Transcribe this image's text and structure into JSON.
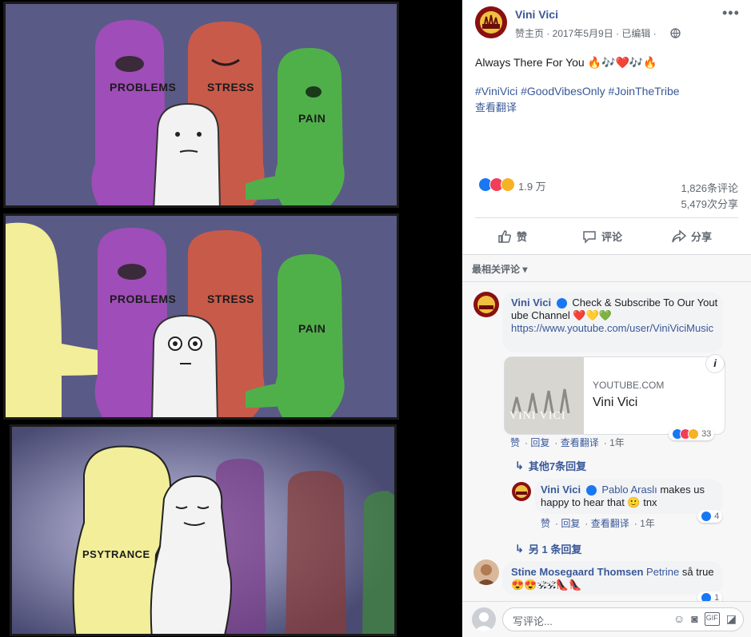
{
  "comic": {
    "panel1": {
      "labels": [
        "PROBLEMS",
        "STRESS",
        "PAIN"
      ]
    },
    "panel2": {
      "labels": [
        "PROBLEMS",
        "STRESS",
        "PAIN"
      ]
    },
    "panel3": {
      "label": "PSYTRANCE"
    }
  },
  "post": {
    "page_name": "Vini Vici",
    "meta": "赞主页 · 2017年5月9日 · 已编辑 ·",
    "text": "Always There For You 🔥🎶❤️🎶🔥",
    "hashtags": "#ViniVici #GoodVibesOnly #JoinTheTribe",
    "translate": "查看翻译",
    "reactions_count": "1.9 万",
    "comments_count": "1,826条评论",
    "shares_count": "5,479次分享",
    "like_label": "赞",
    "comment_label": "评论",
    "share_label": "分享",
    "sort_label": "最相关评论 ▾"
  },
  "comments": [
    {
      "author": "Vini Vici",
      "text": "Check & Subscribe To Our Youtube Channel ❤️💛💚",
      "link": "https://www.youtube.com/user/ViniViciMusic",
      "preview_domain": "YOUTUBE.COM",
      "preview_title": "Vini Vici",
      "preview_image_text": "VINI VICI",
      "actions": [
        "赞",
        "回复",
        "查看翻译",
        "1年"
      ],
      "reactions": "33",
      "more_replies": "其他7条回复"
    },
    {
      "author": "Vini Vici",
      "mention": "Pablo Araslı",
      "text": " makes us happy to hear that 🙂 tnx",
      "actions": [
        "赞",
        "回复",
        "查看翻译",
        "1年"
      ],
      "reactions": "4",
      "more_replies": "另 1 条回复"
    },
    {
      "author": "Stine Mosegaard Thomsen",
      "mention": "Petrine",
      "text": " så true😍😍🕉🕉👠👠",
      "reactions": "1"
    }
  ],
  "composer": {
    "placeholder": "写评论..."
  },
  "colors": {
    "facebook_blue": "#385898",
    "like_blue": "#1877f2",
    "love_red": "#f33e58",
    "muted": "#606770",
    "bubble": "#f2f3f5"
  }
}
